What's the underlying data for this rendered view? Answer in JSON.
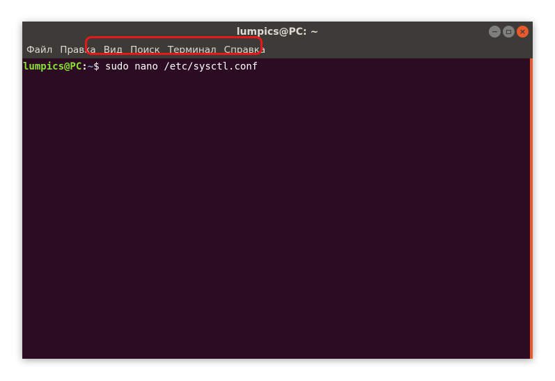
{
  "window": {
    "title": "lumpics@PC: ~"
  },
  "menu": {
    "items": [
      "Файл",
      "Правка",
      "Вид",
      "Поиск",
      "Терминал",
      "Справка"
    ]
  },
  "terminal": {
    "user_host": "lumpics@PC",
    "separator": ":",
    "path": "~",
    "prompt_symbol": "$",
    "command": "sudo nano /etc/sysctl.conf"
  },
  "colors": {
    "titlebar": "#3c3b37",
    "terminal_bg": "#2c0c22",
    "user_host": "#8ae234",
    "path": "#729fcf",
    "close_button": "#e9592c",
    "highlight": "#e81818"
  },
  "icons": {
    "minimize": "minimize-icon",
    "maximize": "maximize-icon",
    "close": "close-icon"
  }
}
